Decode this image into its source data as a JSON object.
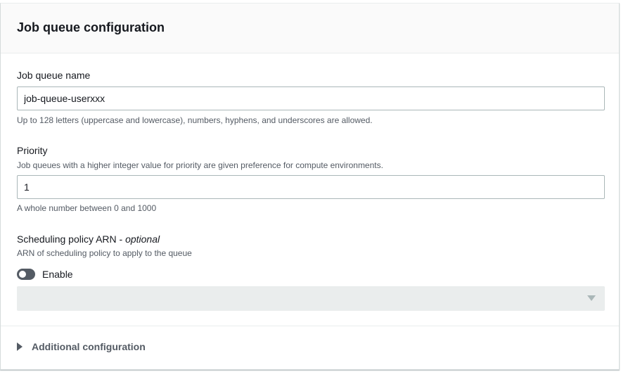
{
  "panel": {
    "title": "Job queue configuration"
  },
  "job_queue_name": {
    "label": "Job queue name",
    "value": "job-queue-userxxx",
    "constraint": "Up to 128 letters (uppercase and lowercase), numbers, hyphens, and underscores are allowed."
  },
  "priority": {
    "label": "Priority",
    "description": "Job queues with a higher integer value for priority are given preference for compute environments.",
    "value": "1",
    "constraint": "A whole number between 0 and 1000"
  },
  "scheduling_policy": {
    "label": "Scheduling policy ARN - ",
    "optional_label": "optional",
    "description": "ARN of scheduling policy to apply to the queue",
    "toggle_label": "Enable",
    "toggle_on": false,
    "select_value": ""
  },
  "additional_configuration": {
    "label": "Additional configuration"
  },
  "icons": {
    "toggle": "toggle-switch",
    "select_caret": "caret-down-icon",
    "expander_caret": "caret-right-icon"
  }
}
